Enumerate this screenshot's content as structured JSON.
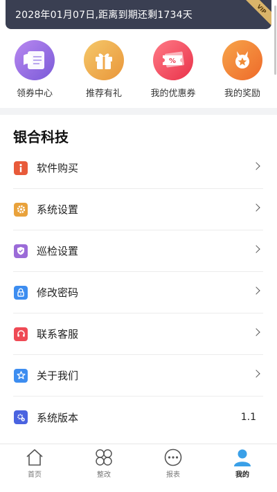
{
  "vip_bar": {
    "text": "2028年01月07日,距离到期还剩1734天",
    "badge": "VIP"
  },
  "quick_actions": [
    {
      "label": "领券中心",
      "icon": "coupon-center-icon",
      "color": "#8a64e0"
    },
    {
      "label": "推荐有礼",
      "icon": "gift-icon",
      "color": "#ee9e3c"
    },
    {
      "label": "我的优惠券",
      "icon": "discount-ticket-icon",
      "color": "#ec3a50"
    },
    {
      "label": "我的奖励",
      "icon": "reward-medal-icon",
      "color": "#f07a30"
    }
  ],
  "company_name": "银合科技",
  "menu": [
    {
      "label": "软件购买",
      "icon": "info-icon",
      "color": "#e85a3a"
    },
    {
      "label": "系统设置",
      "icon": "gear-icon",
      "color": "#e9a23b"
    },
    {
      "label": "巡检设置",
      "icon": "shield-icon",
      "color": "#9b6bd8"
    },
    {
      "label": "修改密码",
      "icon": "lock-icon",
      "color": "#3d8df0"
    },
    {
      "label": "联系客服",
      "icon": "headset-icon",
      "color": "#ef4a55"
    },
    {
      "label": "关于我们",
      "icon": "star-icon",
      "color": "#3d8df0"
    },
    {
      "label": "系统版本",
      "icon": "version-gear-icon",
      "color": "#4a63e0",
      "value": "1.1"
    }
  ],
  "tabbar": [
    {
      "label": "首页",
      "icon": "home-icon"
    },
    {
      "label": "整改",
      "icon": "grid-icon"
    },
    {
      "label": "报表",
      "icon": "chat-dots-icon"
    },
    {
      "label": "我的",
      "icon": "user-icon",
      "active": true
    }
  ]
}
